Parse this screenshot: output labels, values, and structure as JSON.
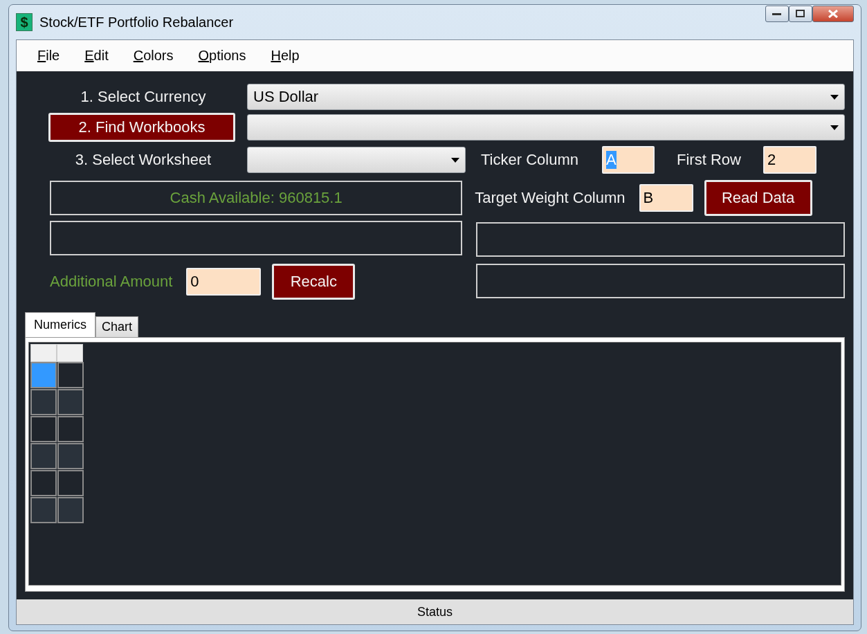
{
  "window": {
    "title": "Stock/ETF Portfolio Rebalancer",
    "app_icon": "$"
  },
  "menu": [
    {
      "label": "File"
    },
    {
      "label": "Edit"
    },
    {
      "label": "Colors"
    },
    {
      "label": "Options"
    },
    {
      "label": "Help"
    }
  ],
  "currency": {
    "label": "1. Select Currency",
    "value": "US Dollar"
  },
  "workbooks": {
    "button": "2. Find Workbooks"
  },
  "worksheet": {
    "label": "3. Select Worksheet"
  },
  "ticker_column": {
    "label": "Ticker Column",
    "value": "A",
    "text_selected": true
  },
  "first_row": {
    "label": "First Row",
    "value": "2",
    "text_selected": false
  },
  "target_weight_column": {
    "label": "Target Weight Column",
    "value": "B",
    "text_selected": false
  },
  "read_data": {
    "button": "Read Data"
  },
  "cash_box": {
    "text": "Cash Available: 960815.1"
  },
  "additional_amount": {
    "label": "Additional Amount",
    "value": "0",
    "text_selected": false
  },
  "recalc": {
    "button": "Recalc"
  },
  "tabs": [
    {
      "label": "Numerics",
      "selected": true
    },
    {
      "label": "Chart",
      "selected": false
    }
  ],
  "grid": {
    "rows": [
      {
        "cells": [
          {
            "selected": true
          },
          {
            "selected": false
          }
        ]
      },
      {
        "cells": [
          {
            "selected": false
          },
          {
            "selected": false
          }
        ]
      },
      {
        "cells": [
          {
            "selected": false
          },
          {
            "selected": false
          }
        ]
      },
      {
        "cells": [
          {
            "selected": false
          },
          {
            "selected": false
          }
        ]
      },
      {
        "cells": [
          {
            "selected": false
          },
          {
            "selected": false
          }
        ]
      },
      {
        "cells": [
          {
            "selected": false
          },
          {
            "selected": false
          }
        ]
      }
    ]
  },
  "status_bar": {
    "text": "Status"
  }
}
